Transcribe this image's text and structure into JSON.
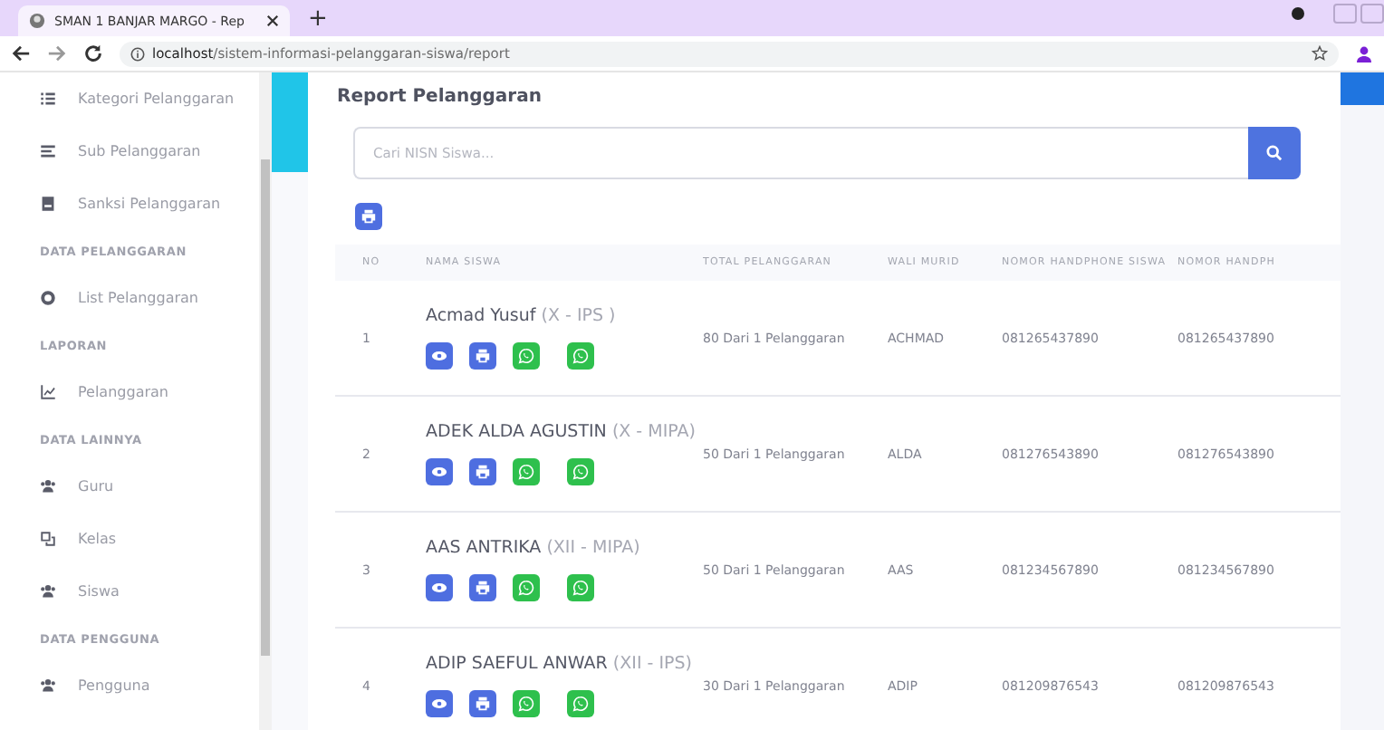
{
  "browser": {
    "tab_title": "SMAN 1 BANJAR MARGO - Rep",
    "new_tab": "+",
    "url_host": "localhost",
    "url_path": "/sistem-informasi-pelanggaran-siswa/report"
  },
  "sidebar": {
    "items": [
      {
        "kind": "item",
        "label": "Kategori Pelanggaran"
      },
      {
        "kind": "item",
        "label": "Sub Pelanggaran"
      },
      {
        "kind": "item",
        "label": "Sanksi Pelanggaran"
      },
      {
        "kind": "heading",
        "label": "DATA PELANGGARAN"
      },
      {
        "kind": "item",
        "label": "List Pelanggaran"
      },
      {
        "kind": "heading",
        "label": "LAPORAN"
      },
      {
        "kind": "item",
        "label": "Pelanggaran"
      },
      {
        "kind": "heading",
        "label": "DATA LAINNYA"
      },
      {
        "kind": "item",
        "label": "Guru"
      },
      {
        "kind": "item",
        "label": "Kelas"
      },
      {
        "kind": "item",
        "label": "Siswa"
      },
      {
        "kind": "heading",
        "label": "DATA PENGGUNA"
      },
      {
        "kind": "item",
        "label": "Pengguna"
      }
    ]
  },
  "main": {
    "title": "Report Pelanggaran",
    "search": {
      "placeholder": "Cari NISN Siswa..."
    },
    "table": {
      "columns": [
        "NO",
        "NAMA SISWA",
        "TOTAL PELANGGARAN",
        "WALI MURID",
        "NOMOR HANDPHONE SISWA",
        "NOMOR HANDPH"
      ],
      "rows": [
        {
          "no": "1",
          "name": "Acmad Yusuf",
          "class": "(X - IPS )",
          "total": "80 Dari 1 Pelanggaran",
          "wali": "ACHMAD",
          "phone": "081265437890",
          "phone_2": "081265437890"
        },
        {
          "no": "2",
          "name": "ADEK ALDA AGUSTIN",
          "class": "(X - MIPA)",
          "total": "50 Dari 1 Pelanggaran",
          "wali": "ALDA",
          "phone": "081276543890",
          "phone_2": "081276543890"
        },
        {
          "no": "3",
          "name": "AAS ANTRIKA",
          "class": "(XII - MIPA)",
          "total": "50 Dari 1 Pelanggaran",
          "wali": "AAS",
          "phone": "081234567890",
          "phone_2": "081234567890"
        },
        {
          "no": "4",
          "name": "ADIP SAEFUL ANWAR",
          "class": "(XII - IPS)",
          "total": "30 Dari 1 Pelanggaran",
          "wali": "ADIP",
          "phone": "081209876543",
          "phone_2": "081209876543"
        }
      ]
    }
  }
}
